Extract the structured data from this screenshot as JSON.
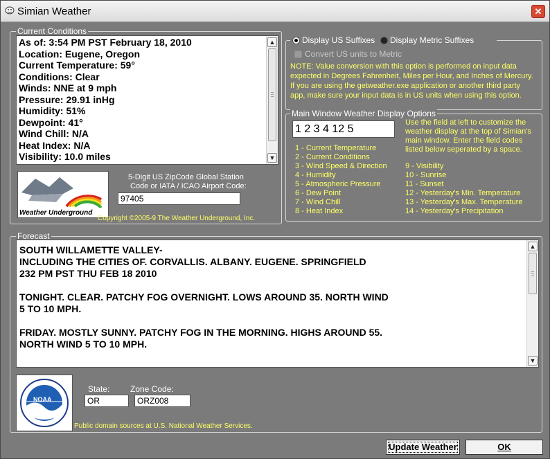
{
  "window": {
    "title": "Simian Weather",
    "close_symbol": "✕"
  },
  "current_conditions": {
    "legend": "Current Conditions",
    "lines": [
      "As of: 3:54 PM PST February 18, 2010",
      "Location: Eugene, Oregon",
      "Current Temperature: 59°",
      "Conditions: Clear",
      "Winds: NNE at 9 mph",
      "Pressure: 29.91 inHg",
      "Humidity: 51%",
      "Dewpoint: 41°",
      "Wind Chill: N/A",
      "Heat Index: N/A",
      "Visibility: 10.0 miles"
    ],
    "wu_logo_text": "Weather Underground",
    "zip_label_1": "5-Digit US ZipCode  Global Station",
    "zip_label_2": "Code or IATA / ICAO Airport Code:",
    "zip_value": "97405",
    "copyright": "Copyright ©2005-9 The Weather Underground, Inc."
  },
  "units": {
    "us_label": "Display US Suffixes",
    "metric_label": "Display Metric Suffixes",
    "us_selected": true,
    "convert_label": "Convert US units to Metric",
    "note": [
      "NOTE: Value conversion with this option is performed on input data",
      "expected in Degrees Fahrenheit, Miles per Hour, and Inches of Mercury.",
      " If you are using the getweather.exe application or another third party",
      "app, make sure your input data is in US units when using this option."
    ]
  },
  "display_options": {
    "legend": "Main Window Weather Display Options",
    "field_value": "1 2 3 4 12 5",
    "help": [
      "Use the field at left to customize the",
      "weather display at the top of Simian's",
      "main window.  Enter the field codes",
      "listed below seperated by a space."
    ],
    "codes_left": [
      "1 - Current Temperature",
      "2 - Current Conditions",
      "3 - Wind Speed & Direction",
      "4 - Humidity",
      "5 - Atmospheric Pressure",
      "6 - Dew Point",
      "7 - Wind Chill",
      "8 - Heat Index"
    ],
    "codes_right": [
      "9 - Visibility",
      "10 - Sunrise",
      "11 - Sunset",
      "12 - Yesterday's Min. Temperature",
      "13 - Yesterday's Max. Temperature",
      "14 - Yesterday's Precipitation"
    ]
  },
  "forecast": {
    "legend": "Forecast",
    "text": "SOUTH WILLAMETTE VALLEY-\nINCLUDING THE CITIES OF. CORVALLIS. ALBANY. EUGENE. SPRINGFIELD\n232 PM PST THU FEB 18 2010\n\nTONIGHT. CLEAR. PATCHY FOG OVERNIGHT. LOWS AROUND 35. NORTH WIND\n5 TO 10 MPH.\n\nFRIDAY. MOSTLY SUNNY. PATCHY FOG IN THE MORNING. HIGHS AROUND 55.\nNORTH WIND 5 TO 10 MPH.",
    "noaa_logo_text": "NOAA",
    "state_label": "State:",
    "state_value": "OR",
    "zone_label": "Zone Code:",
    "zone_value": "ORZ008",
    "source": "Public domain sources at U.S. National Weather Services."
  },
  "buttons": {
    "update": "Update Weather",
    "ok": "OK"
  },
  "colors": {
    "background": "#7b7b7b",
    "highlight_text": "#ffff66",
    "close_red": "#d84a33"
  }
}
